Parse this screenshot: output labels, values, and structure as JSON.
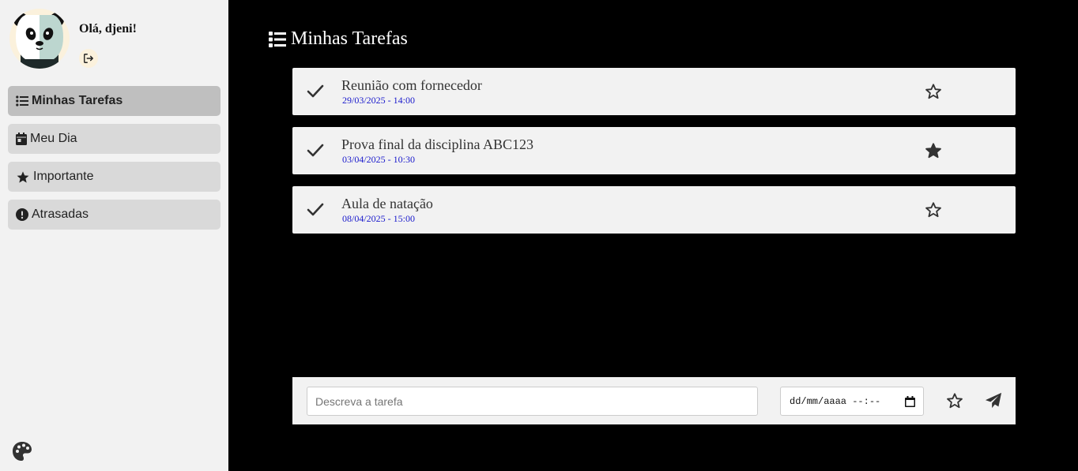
{
  "user": {
    "greeting": "Olá, djeni!"
  },
  "sidebar": {
    "items": [
      {
        "label": "Minhas Tarefas",
        "icon": "list-icon",
        "active": true
      },
      {
        "label": "Meu Dia",
        "icon": "calendar-icon",
        "active": false
      },
      {
        "label": "Importante",
        "icon": "star-icon",
        "active": false
      },
      {
        "label": "Atrasadas",
        "icon": "exclamation-circle-icon",
        "active": false
      }
    ]
  },
  "main": {
    "title": "Minhas Tarefas",
    "tasks": [
      {
        "title": "Reunião com fornecedor",
        "datetime": "29/03/2025 - 14:00",
        "important": false
      },
      {
        "title": "Prova final da disciplina ABC123",
        "datetime": "03/04/2025 - 10:30",
        "important": true
      },
      {
        "title": "Aula de natação",
        "datetime": "08/04/2025 - 15:00",
        "important": false
      }
    ]
  },
  "composer": {
    "description_placeholder": "Descreva a tarefa",
    "description_value": "",
    "datetime_placeholder": "dd/mm/aaaa --:--"
  },
  "colors": {
    "sidebar_bg": "#f2f2f2",
    "main_bg": "#000000",
    "nav_item_bg": "#d9d9d9",
    "nav_item_active_bg": "#bfbfbf",
    "task_card_bg": "#f2f2f2",
    "date_text": "#1a1acc"
  }
}
